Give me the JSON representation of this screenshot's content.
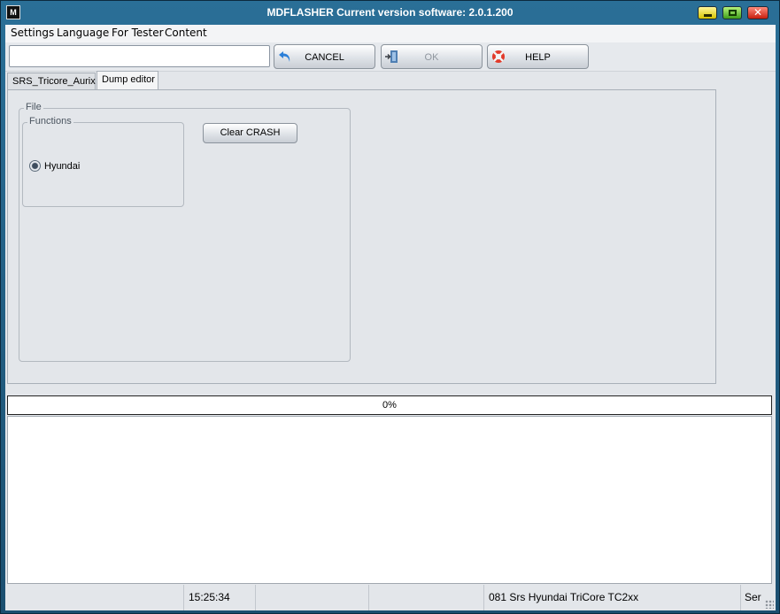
{
  "window": {
    "title": "MDFLASHER  Current version software: 2.0.1.200",
    "icon_label": "M"
  },
  "menu": {
    "items": [
      {
        "label": "Settings"
      },
      {
        "label": "Language"
      },
      {
        "label": "For Tester"
      },
      {
        "label": "Content"
      }
    ]
  },
  "toolbar": {
    "input_value": "",
    "cancel_label": "CANCEL",
    "ok_label": "OK",
    "help_label": "HELP",
    "ok_enabled": false
  },
  "tabs": [
    {
      "label": "SRS_Tricore_Aurix",
      "active": false
    },
    {
      "label": "Dump editor",
      "active": true
    }
  ],
  "dump_editor": {
    "file_group_title": "File",
    "functions_group_title": "Functions",
    "radio_option": {
      "label": "Hyundai",
      "selected": true
    },
    "clear_button_label": "Clear CRASH"
  },
  "progress": {
    "value": 0,
    "label": "0%"
  },
  "statusbar": {
    "cells": [
      "",
      "15:25:34",
      "",
      "",
      "081 Srs Hyundai TriCore TC2xx",
      "Ser"
    ]
  },
  "colors": {
    "titlebar": "#1b4f70",
    "client_bg": "#e3e6ea",
    "cancel_icon": "#2b7fd8",
    "help_icon": "#e23a2a"
  }
}
